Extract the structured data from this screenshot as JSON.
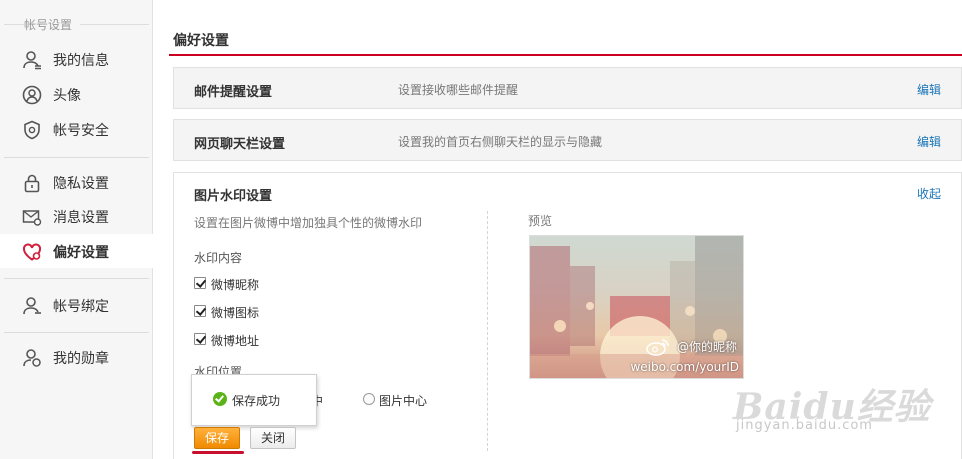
{
  "sidebar": {
    "group_title": "帐号设置",
    "items": [
      {
        "label": "我的信息",
        "icon": "user-icon"
      },
      {
        "label": "头像",
        "icon": "avatar-icon"
      },
      {
        "label": "帐号安全",
        "icon": "shield-icon"
      },
      {
        "label": "隐私设置",
        "icon": "lock-icon"
      },
      {
        "label": "消息设置",
        "icon": "mail-settings-icon"
      },
      {
        "label": "偏好设置",
        "icon": "heart-settings-icon",
        "active": true
      },
      {
        "label": "帐号绑定",
        "icon": "user-link-icon"
      },
      {
        "label": "我的勋章",
        "icon": "medal-icon"
      }
    ]
  },
  "main": {
    "title": "偏好设置",
    "sections": [
      {
        "title": "邮件提醒设置",
        "desc": "设置接收哪些邮件提醒",
        "link": "编辑"
      },
      {
        "title": "网页聊天栏设置",
        "desc": "设置我的首页右侧聊天栏的显示与隐藏",
        "link": "编辑"
      }
    ],
    "watermark": {
      "title": "图片水印设置",
      "link": "收起",
      "desc": "设置在图片微博中增加独具个性的微博水印",
      "content_label": "水印内容",
      "options": [
        "微博昵称",
        "微博图标",
        "微博地址"
      ],
      "position_label": "水印位置",
      "positions": [
        "居中",
        "图片中心"
      ],
      "preview_label": "预览",
      "preview_nick": "@你的昵称",
      "preview_url": "weibo.com/yourID",
      "save_label": "保存",
      "close_label": "关闭",
      "toast": "保存成功"
    }
  },
  "brand": {
    "name": "Baidu经验",
    "url": "jingyan.baidu.com"
  },
  "colors": {
    "accent_rule": "#c9001f",
    "link": "#1a75b8",
    "save_button": "#f08a00"
  }
}
